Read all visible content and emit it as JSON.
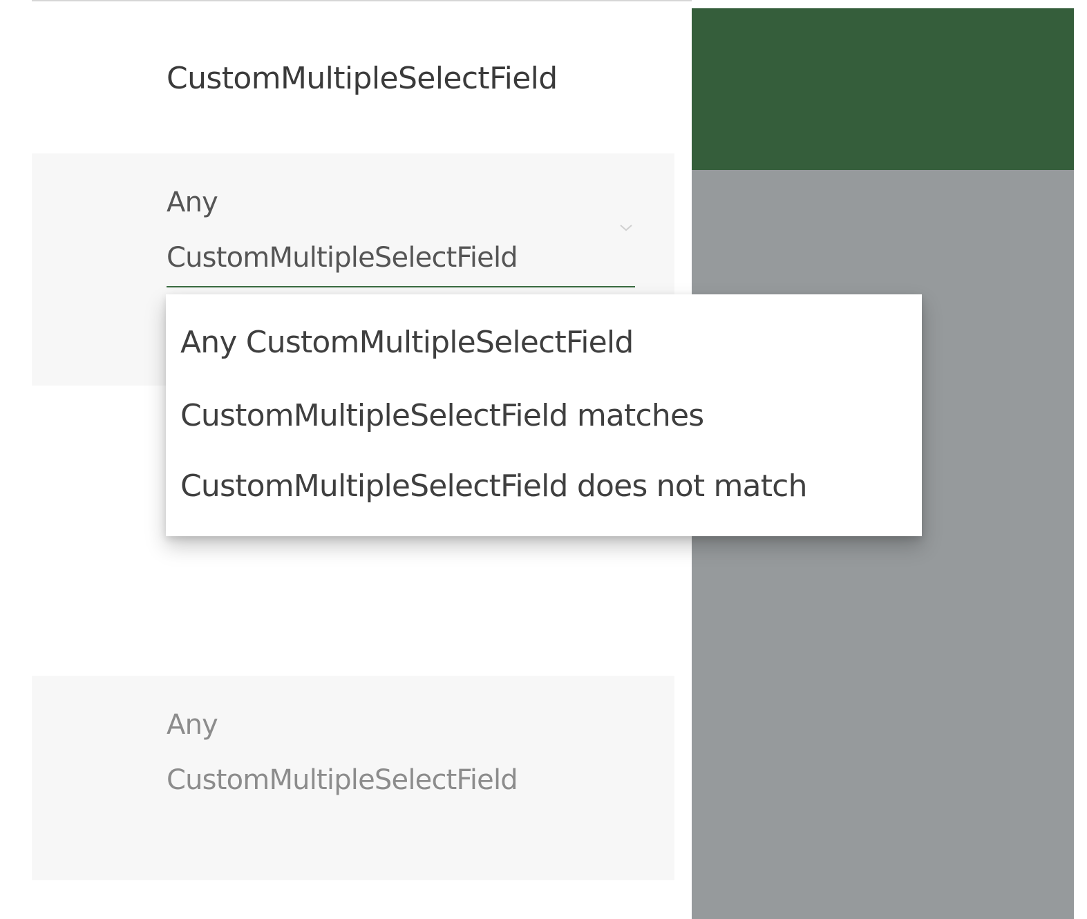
{
  "filter_panel": {
    "title": "CustomMultipleSelectField",
    "active_filter": {
      "selected_line_1": "Any",
      "selected_line_2": "CustomMultipleSelectField"
    },
    "second_filter": {
      "selected_line_1": "Any",
      "selected_line_2": "CustomMultipleSelectField"
    }
  },
  "dropdown": {
    "options": [
      "Any CustomMultipleSelectField",
      "CustomMultipleSelectField matches",
      "CustomMultipleSelectField does not match"
    ]
  },
  "colors": {
    "header_green": "#355e3b",
    "overlay_gray": "#969a9c",
    "field_underline": "#3a6b40",
    "card_background": "#f7f7f7"
  }
}
